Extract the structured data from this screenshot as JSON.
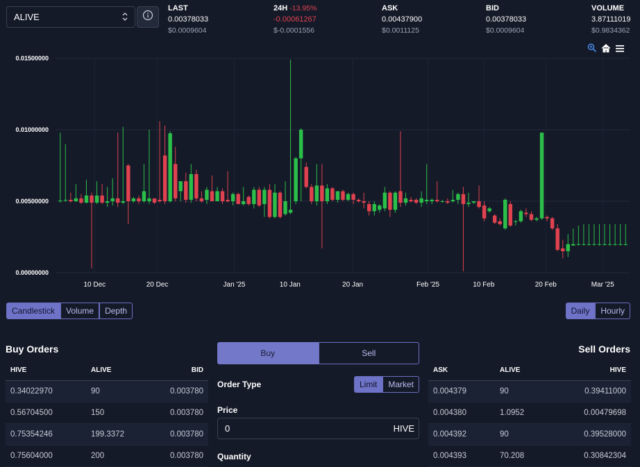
{
  "header": {
    "pair": "ALIVE",
    "stats": {
      "last": {
        "label": "LAST",
        "value": "0.00378033",
        "usd": "$0.0009604"
      },
      "change": {
        "label": "24H",
        "pct": "-13.95%",
        "value": "-0.00061267",
        "usd": "$-0.0001556"
      },
      "ask": {
        "label": "ASK",
        "value": "0.00437900",
        "usd": "$0.0011125"
      },
      "bid": {
        "label": "BID",
        "value": "0.00378033",
        "usd": "$0.0009604"
      },
      "volume": {
        "label": "VOLUME",
        "value": "3.87111019",
        "usd": "$0.9834362"
      }
    }
  },
  "chart_data": {
    "type": "candlestick",
    "y_ticks": [
      "0.01500000",
      "0.01000000",
      "0.00500000",
      "0.00000000"
    ],
    "ylim": [
      0,
      0.015
    ],
    "x_ticks": [
      "10 Dec",
      "20 Dec",
      "Jan '25",
      "10 Jan",
      "20 Jan",
      "Feb '25",
      "10 Feb",
      "20 Feb",
      "Mar '25"
    ],
    "up_color": "#2bbf4a",
    "down_color": "#e0424f",
    "candles": [
      {
        "o": 0.005,
        "h": 0.0098,
        "l": 0.0049,
        "c": 0.00505
      },
      {
        "o": 0.00505,
        "h": 0.009,
        "l": 0.00495,
        "c": 0.0051
      },
      {
        "o": 0.0051,
        "h": 0.0056,
        "l": 0.0049,
        "c": 0.005
      },
      {
        "o": 0.005,
        "h": 0.0062,
        "l": 0.00495,
        "c": 0.0052
      },
      {
        "o": 0.0052,
        "h": 0.0055,
        "l": 0.0048,
        "c": 0.0049
      },
      {
        "o": 0.0049,
        "h": 0.0065,
        "l": 0.00485,
        "c": 0.0054
      },
      {
        "o": 0.0054,
        "h": 0.0056,
        "l": 0.0003,
        "c": 0.0049
      },
      {
        "o": 0.0049,
        "h": 0.0064,
        "l": 0.0048,
        "c": 0.0054
      },
      {
        "o": 0.0054,
        "h": 0.0062,
        "l": 0.0048,
        "c": 0.0049
      },
      {
        "o": 0.0049,
        "h": 0.006,
        "l": 0.0046,
        "c": 0.005
      },
      {
        "o": 0.005,
        "h": 0.0066,
        "l": 0.0047,
        "c": 0.0052
      },
      {
        "o": 0.0052,
        "h": 0.0098,
        "l": 0.0046,
        "c": 0.0049
      },
      {
        "o": 0.0049,
        "h": 0.0102,
        "l": 0.0048,
        "c": 0.005
      },
      {
        "o": 0.0075,
        "h": 0.0076,
        "l": 0.0034,
        "c": 0.005
      },
      {
        "o": 0.005,
        "h": 0.0053,
        "l": 0.0049,
        "c": 0.0052
      },
      {
        "o": 0.0052,
        "h": 0.0054,
        "l": 0.0048,
        "c": 0.005
      },
      {
        "o": 0.005,
        "h": 0.0076,
        "l": 0.0049,
        "c": 0.0057
      },
      {
        "o": 0.005,
        "h": 0.01,
        "l": 0.0048,
        "c": 0.0052
      },
      {
        "o": 0.0052,
        "h": 0.0052,
        "l": 0.0048,
        "c": 0.0049
      },
      {
        "o": 0.0051,
        "h": 0.0106,
        "l": 0.0049,
        "c": 0.005
      },
      {
        "o": 0.0082,
        "h": 0.0103,
        "l": 0.0048,
        "c": 0.005
      },
      {
        "o": 0.005,
        "h": 0.0099,
        "l": 0.0049,
        "c": 0.00975
      },
      {
        "o": 0.0076,
        "h": 0.0088,
        "l": 0.005,
        "c": 0.0052
      },
      {
        "o": 0.0057,
        "h": 0.0064,
        "l": 0.005,
        "c": 0.0064
      },
      {
        "o": 0.0064,
        "h": 0.007,
        "l": 0.0049,
        "c": 0.0051
      },
      {
        "o": 0.0051,
        "h": 0.0076,
        "l": 0.0049,
        "c": 0.0069
      },
      {
        "o": 0.0069,
        "h": 0.0072,
        "l": 0.005,
        "c": 0.0052
      },
      {
        "o": 0.0052,
        "h": 0.0057,
        "l": 0.0049,
        "c": 0.005
      },
      {
        "o": 0.0051,
        "h": 0.006,
        "l": 0.0048,
        "c": 0.0058
      },
      {
        "o": 0.0057,
        "h": 0.0068,
        "l": 0.005,
        "c": 0.005
      },
      {
        "o": 0.005,
        "h": 0.006,
        "l": 0.005,
        "c": 0.0057
      },
      {
        "o": 0.0057,
        "h": 0.0059,
        "l": 0.0048,
        "c": 0.005
      },
      {
        "o": 0.0051,
        "h": 0.0071,
        "l": 0.0049,
        "c": 0.005
      },
      {
        "o": 0.005,
        "h": 0.0056,
        "l": 0.0047,
        "c": 0.0055
      },
      {
        "o": 0.0055,
        "h": 0.0056,
        "l": 0.0048,
        "c": 0.0048
      },
      {
        "o": 0.0048,
        "h": 0.006,
        "l": 0.0047,
        "c": 0.005
      },
      {
        "o": 0.0053,
        "h": 0.0054,
        "l": 0.0047,
        "c": 0.0048
      },
      {
        "o": 0.0048,
        "h": 0.006,
        "l": 0.0045,
        "c": 0.0058
      },
      {
        "o": 0.0058,
        "h": 0.006,
        "l": 0.0046,
        "c": 0.0047
      },
      {
        "o": 0.0048,
        "h": 0.006,
        "l": 0.0039,
        "c": 0.0058
      },
      {
        "o": 0.0058,
        "h": 0.0062,
        "l": 0.0038,
        "c": 0.0039
      },
      {
        "o": 0.0039,
        "h": 0.0062,
        "l": 0.0038,
        "c": 0.0056
      },
      {
        "o": 0.0056,
        "h": 0.0057,
        "l": 0.0038,
        "c": 0.0039
      },
      {
        "o": 0.0041,
        "h": 0.0064,
        "l": 0.004,
        "c": 0.005
      },
      {
        "o": 0.0042,
        "h": 0.0149,
        "l": 0.0041,
        "c": 0.0044
      },
      {
        "o": 0.005,
        "h": 0.0081,
        "l": 0.0048,
        "c": 0.008
      },
      {
        "o": 0.008,
        "h": 0.0101,
        "l": 0.005,
        "c": 0.01
      },
      {
        "o": 0.0074,
        "h": 0.0077,
        "l": 0.0059,
        "c": 0.006
      },
      {
        "o": 0.006,
        "h": 0.0062,
        "l": 0.0048,
        "c": 0.005
      },
      {
        "o": 0.005,
        "h": 0.0076,
        "l": 0.0047,
        "c": 0.0061
      },
      {
        "o": 0.0061,
        "h": 0.0076,
        "l": 0.0017,
        "c": 0.005
      },
      {
        "o": 0.005,
        "h": 0.0062,
        "l": 0.0048,
        "c": 0.0059
      },
      {
        "o": 0.0059,
        "h": 0.006,
        "l": 0.005,
        "c": 0.0051
      },
      {
        "o": 0.0051,
        "h": 0.0057,
        "l": 0.0049,
        "c": 0.0057
      },
      {
        "o": 0.0057,
        "h": 0.0058,
        "l": 0.005,
        "c": 0.0051
      },
      {
        "o": 0.0051,
        "h": 0.0056,
        "l": 0.005,
        "c": 0.0055
      },
      {
        "o": 0.0055,
        "h": 0.0056,
        "l": 0.0048,
        "c": 0.0051
      },
      {
        "o": 0.0051,
        "h": 0.0052,
        "l": 0.0049,
        "c": 0.005
      },
      {
        "o": 0.005,
        "h": 0.0056,
        "l": 0.0045,
        "c": 0.0049
      },
      {
        "o": 0.0048,
        "h": 0.005,
        "l": 0.004,
        "c": 0.0043
      },
      {
        "o": 0.0043,
        "h": 0.005,
        "l": 0.004,
        "c": 0.0048
      },
      {
        "o": 0.0044,
        "h": 0.0048,
        "l": 0.0042,
        "c": 0.0047
      },
      {
        "o": 0.0045,
        "h": 0.006,
        "l": 0.0043,
        "c": 0.0056
      },
      {
        "o": 0.0056,
        "h": 0.0057,
        "l": 0.0039,
        "c": 0.0044
      },
      {
        "o": 0.0044,
        "h": 0.0057,
        "l": 0.0042,
        "c": 0.0056
      },
      {
        "o": 0.0057,
        "h": 0.0099,
        "l": 0.0046,
        "c": 0.0049
      },
      {
        "o": 0.0049,
        "h": 0.0056,
        "l": 0.0047,
        "c": 0.0052
      },
      {
        "o": 0.0051,
        "h": 0.0053,
        "l": 0.0049,
        "c": 0.005
      },
      {
        "o": 0.0051,
        "h": 0.0052,
        "l": 0.0048,
        "c": 0.0049
      },
      {
        "o": 0.0049,
        "h": 0.0057,
        "l": 0.0046,
        "c": 0.0052
      },
      {
        "o": 0.005,
        "h": 0.0076,
        "l": 0.0048,
        "c": 0.0051
      },
      {
        "o": 0.005,
        "h": 0.0052,
        "l": 0.0048,
        "c": 0.0051
      },
      {
        "o": 0.0051,
        "h": 0.0064,
        "l": 0.0049,
        "c": 0.005
      },
      {
        "o": 0.005,
        "h": 0.0051,
        "l": 0.0049,
        "c": 0.005
      },
      {
        "o": 0.005,
        "h": 0.0052,
        "l": 0.0048,
        "c": 0.0049
      },
      {
        "o": 0.005,
        "h": 0.0058,
        "l": 0.0049,
        "c": 0.0051
      },
      {
        "o": 0.0051,
        "h": 0.0056,
        "l": 0.0048,
        "c": 0.0055
      },
      {
        "o": 0.0055,
        "h": 0.006,
        "l": 0.0001,
        "c": 0.0048
      },
      {
        "o": 0.0048,
        "h": 0.0056,
        "l": 0.0046,
        "c": 0.0049
      },
      {
        "o": 0.0049,
        "h": 0.005,
        "l": 0.0048,
        "c": 0.005
      },
      {
        "o": 0.005,
        "h": 0.0061,
        "l": 0.0045,
        "c": 0.0046
      },
      {
        "o": 0.0047,
        "h": 0.005,
        "l": 0.0036,
        "c": 0.0038
      },
      {
        "o": 0.0043,
        "h": 0.0046,
        "l": 0.0042,
        "c": 0.0045
      },
      {
        "o": 0.004,
        "h": 0.0041,
        "l": 0.0034,
        "c": 0.0035
      },
      {
        "o": 0.0036,
        "h": 0.0038,
        "l": 0.0033,
        "c": 0.0034
      },
      {
        "o": 0.0031,
        "h": 0.0052,
        "l": 0.003,
        "c": 0.0051
      },
      {
        "o": 0.0048,
        "h": 0.005,
        "l": 0.0032,
        "c": 0.0033
      },
      {
        "o": 0.0036,
        "h": 0.0037,
        "l": 0.0033,
        "c": 0.0036
      },
      {
        "o": 0.0036,
        "h": 0.0044,
        "l": 0.0035,
        "c": 0.0043
      },
      {
        "o": 0.0042,
        "h": 0.0045,
        "l": 0.0039,
        "c": 0.0041
      },
      {
        "o": 0.0041,
        "h": 0.0043,
        "l": 0.0036,
        "c": 0.0037
      },
      {
        "o": 0.0037,
        "h": 0.0039,
        "l": 0.0036,
        "c": 0.0038
      },
      {
        "o": 0.0038,
        "h": 0.0098,
        "l": 0.0037,
        "c": 0.0098
      },
      {
        "o": 0.0039,
        "h": 0.004,
        "l": 0.0036,
        "c": 0.0038
      },
      {
        "o": 0.0038,
        "h": 0.0039,
        "l": 0.003,
        "c": 0.0031
      },
      {
        "o": 0.0031,
        "h": 0.0034,
        "l": 0.0015,
        "c": 0.0016
      },
      {
        "o": 0.0017,
        "h": 0.0023,
        "l": 0.001,
        "c": 0.0015
      },
      {
        "o": 0.0015,
        "h": 0.0027,
        "l": 0.0011,
        "c": 0.002
      },
      {
        "o": 0.0019,
        "h": 0.0031,
        "l": 0.0019,
        "c": 0.002
      },
      {
        "o": 0.002,
        "h": 0.0033,
        "l": 0.0019,
        "c": 0.002
      },
      {
        "o": 0.002,
        "h": 0.0034,
        "l": 0.0019,
        "c": 0.002
      },
      {
        "o": 0.002,
        "h": 0.0034,
        "l": 0.0019,
        "c": 0.002
      },
      {
        "o": 0.002,
        "h": 0.0034,
        "l": 0.0019,
        "c": 0.002
      },
      {
        "o": 0.002,
        "h": 0.0034,
        "l": 0.0019,
        "c": 0.002
      },
      {
        "o": 0.002,
        "h": 0.0034,
        "l": 0.0019,
        "c": 0.002
      },
      {
        "o": 0.002,
        "h": 0.0034,
        "l": 0.0019,
        "c": 0.002
      },
      {
        "o": 0.002,
        "h": 0.0034,
        "l": 0.0019,
        "c": 0.002
      },
      {
        "o": 0.002,
        "h": 0.0034,
        "l": 0.0019,
        "c": 0.002
      },
      {
        "o": 0.002,
        "h": 0.0034,
        "l": 0.0019,
        "c": 0.002
      }
    ]
  },
  "chart_tabs": [
    "Candlestick",
    "Volume",
    "Depth"
  ],
  "interval_tabs": [
    "Daily",
    "Hourly"
  ],
  "buy_orders": {
    "title": "Buy Orders",
    "columns": [
      "HIVE",
      "ALIVE",
      "BID"
    ],
    "rows": [
      [
        "0.34022970",
        "90",
        "0.003780"
      ],
      [
        "0.56704500",
        "150",
        "0.003780"
      ],
      [
        "0.75354246",
        "199.3372",
        "0.003780"
      ],
      [
        "0.75604000",
        "200",
        "0.003780"
      ]
    ]
  },
  "sell_orders": {
    "title": "Sell Orders",
    "columns": [
      "ASK",
      "ALIVE",
      "HIVE"
    ],
    "rows": [
      [
        "0.004379",
        "90",
        "0.39411000"
      ],
      [
        "0.004380",
        "1.0952",
        "0.00479698"
      ],
      [
        "0.004392",
        "90",
        "0.39528000"
      ],
      [
        "0.004393",
        "70.208",
        "0.30842304"
      ]
    ]
  },
  "order_form": {
    "buy_label": "Buy",
    "sell_label": "Sell",
    "order_type_label": "Order Type",
    "limit_label": "Limit",
    "market_label": "Market",
    "price_label": "Price",
    "price_value": "0",
    "price_unit": "HIVE",
    "quantity_label": "Quantity"
  }
}
